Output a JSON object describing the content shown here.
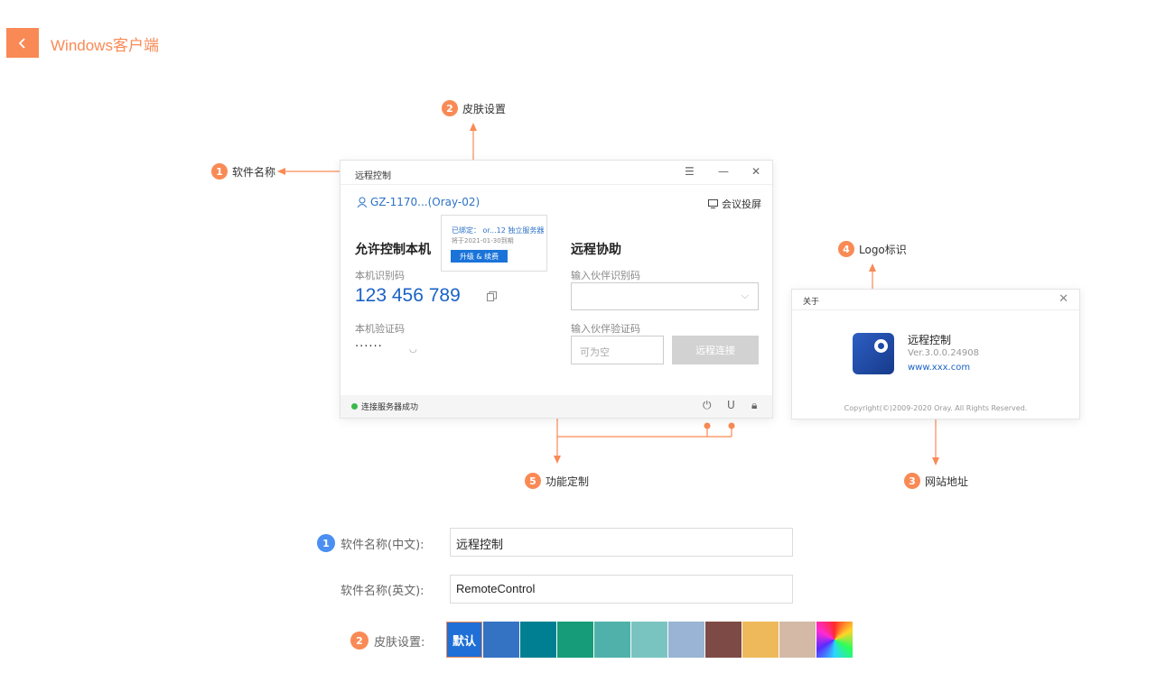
{
  "page": {
    "title": "Windows客户端"
  },
  "annotations": [
    {
      "num": "1",
      "label": "软件名称"
    },
    {
      "num": "2",
      "label": "皮肤设置"
    },
    {
      "num": "3",
      "label": "网站地址"
    },
    {
      "num": "4",
      "label": "Logo标识"
    },
    {
      "num": "5",
      "label": "功能定制"
    }
  ],
  "client_window": {
    "title": "远程控制",
    "user": "GZ-1170...(Oray-02)",
    "meeting_label": "会议投屏",
    "popup": {
      "line1": "已绑定： or...12 独立服务器",
      "line2": "将于2021-01-30到期",
      "button": "升级 & 续费"
    },
    "allow_title": "允许控制本机",
    "id_label": "本机识别码",
    "id_value": "123 456 789",
    "code_label": "本机验证码",
    "code_value": "······",
    "assist_title": "远程协助",
    "partner_id_label": "输入伙伴识别码",
    "partner_code_label": "输入伙伴验证码",
    "partner_code_placeholder": "可为空",
    "connect_button": "远程连接",
    "status": "连接服务器成功"
  },
  "about_dialog": {
    "title": "关于",
    "app_name": "远程控制",
    "version": "Ver.3.0.0.24908",
    "website": "www.xxx.com",
    "copyright": "Copyright(©)2009-2020 Oray. All Rights Reserved."
  },
  "form": {
    "name_cn_num": "1",
    "name_cn_label": "软件名称(中文):",
    "name_cn_value": "远程控制",
    "name_en_label": "软件名称(英文):",
    "name_en_value": "RemoteControl",
    "skin_num": "2",
    "skin_label": "皮肤设置:",
    "default_skin_label": "默认",
    "skin_colors": [
      "#1f6fd6",
      "#3473c4",
      "#007f92",
      "#169c79",
      "#4fb1aa",
      "#79c4c0",
      "#99b4d4",
      "#7e4a45",
      "#eeb95a",
      "#d3b9a6",
      "rainbow"
    ]
  },
  "colors": {
    "accent": "#f98a55",
    "link": "#1a62c4"
  }
}
